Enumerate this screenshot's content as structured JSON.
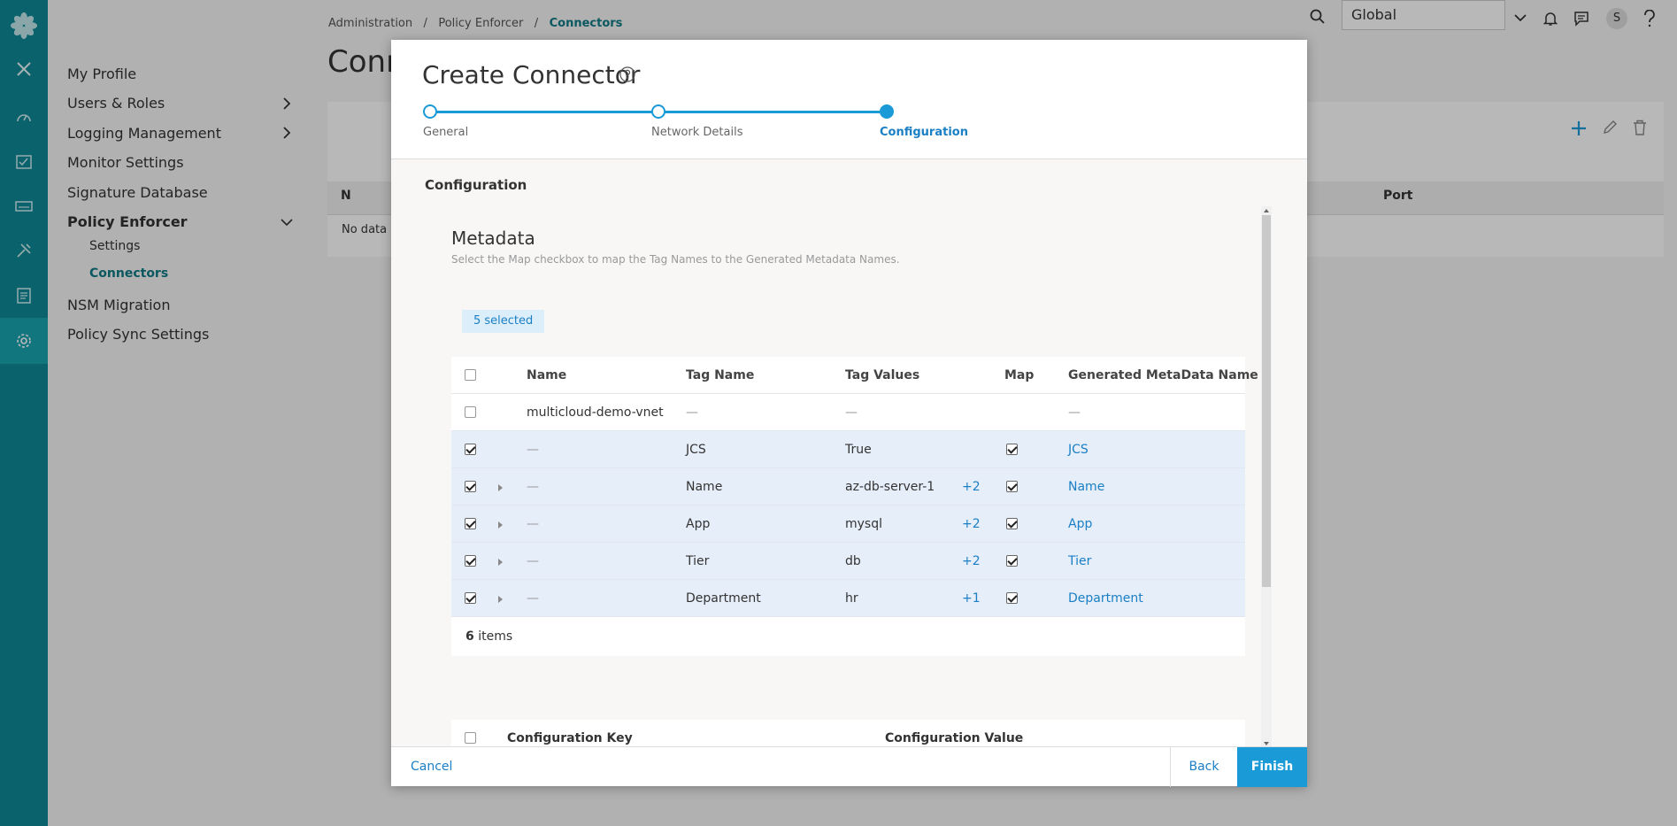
{
  "breadcrumb": [
    "Administration",
    "Policy Enforcer",
    "Connectors"
  ],
  "page_title": "Conn",
  "topbar": {
    "scope": "Global",
    "user_initial": "S"
  },
  "sidebar": {
    "items": [
      {
        "label": "My Profile"
      },
      {
        "label": "Users & Roles"
      },
      {
        "label": "Logging Management"
      },
      {
        "label": "Monitor Settings"
      },
      {
        "label": "Signature Database"
      },
      {
        "label": "Policy Enforcer"
      },
      {
        "label": "NSM Migration"
      },
      {
        "label": "Policy Sync Settings"
      }
    ],
    "sub_items": [
      {
        "label": "Settings"
      },
      {
        "label": "Connectors"
      }
    ]
  },
  "background": {
    "no_data": "No data a",
    "col_n": "N",
    "col_port": "Port"
  },
  "modal": {
    "title": "Create Connector",
    "steps": [
      "General",
      "Network Details",
      "Configuration"
    ],
    "section": "Configuration",
    "metadata_title": "Metadata",
    "metadata_subtitle": "Select the Map checkbox to map the Tag Names to the Generated Metadata Names.",
    "selected_badge": "5 selected",
    "columns": [
      "Name",
      "Tag Name",
      "Tag Values",
      "Map",
      "Generated MetaData Name"
    ],
    "rows": [
      {
        "name": "multicloud-demo-vnet",
        "tag": "—",
        "value": "—",
        "more": "",
        "gen": "—",
        "checked": false,
        "map": false
      },
      {
        "name": "—",
        "tag": "JCS",
        "value": "True",
        "more": "",
        "gen": "JCS",
        "checked": true,
        "map": true
      },
      {
        "name": "—",
        "tag": "Name",
        "value": "az-db-server-1",
        "more": "+2",
        "gen": "Name",
        "checked": true,
        "map": true
      },
      {
        "name": "—",
        "tag": "App",
        "value": "mysql",
        "more": "+2",
        "gen": "App",
        "checked": true,
        "map": true
      },
      {
        "name": "—",
        "tag": "Tier",
        "value": "db",
        "more": "+2",
        "gen": "Tier",
        "checked": true,
        "map": true
      },
      {
        "name": "—",
        "tag": "Department",
        "value": "hr",
        "more": "+1",
        "gen": "Department",
        "checked": true,
        "map": true
      }
    ],
    "items_count": "6",
    "items_label": "items",
    "config_key": "Configuration Key",
    "config_value": "Configuration Value",
    "cancel": "Cancel",
    "back": "Back",
    "finish": "Finish"
  },
  "colors": {
    "rail": "#0f8a96",
    "accent": "#1a9ad6",
    "link": "#1a7fc4"
  }
}
